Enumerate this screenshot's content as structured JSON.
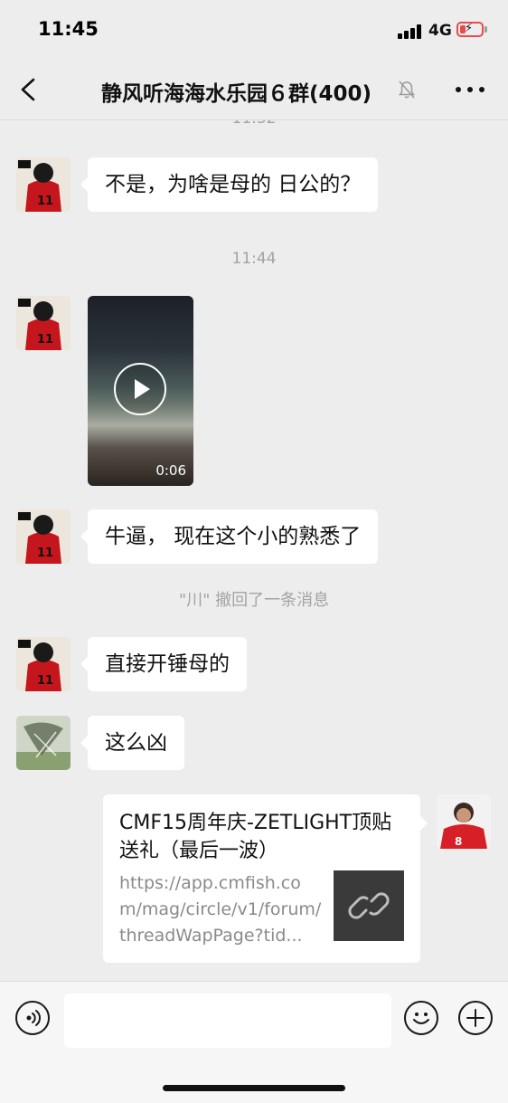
{
  "status_bar": {
    "time": "11:45",
    "network": "4G"
  },
  "header": {
    "title": "静风听海海水乐园６群(400)"
  },
  "messages": {
    "ts_top_partial": "11:32",
    "m1_text": "不是，为啥是母的 日公的？",
    "ts_1144": "11:44",
    "video_duration": "0:06",
    "m3_text": "牛逼， 现在这个小的熟悉了",
    "recall_notice": "\"川\" 撤回了一条消息",
    "m4_text": "直接开锤母的",
    "m5_text": "这么凶",
    "link_card": {
      "title": "CMF15周年庆-ZETLIGHT顶贴送礼（最后一波）",
      "url": "https://app.cmfish.com/mag/circle/v1/forum/threadWapPage?tid..."
    }
  },
  "input_bar": {
    "placeholder": ""
  },
  "icons": [
    "back-icon",
    "mute-bell-icon",
    "more-icon",
    "play-icon",
    "link-icon",
    "voice-icon",
    "emoji-icon",
    "plus-icon"
  ]
}
